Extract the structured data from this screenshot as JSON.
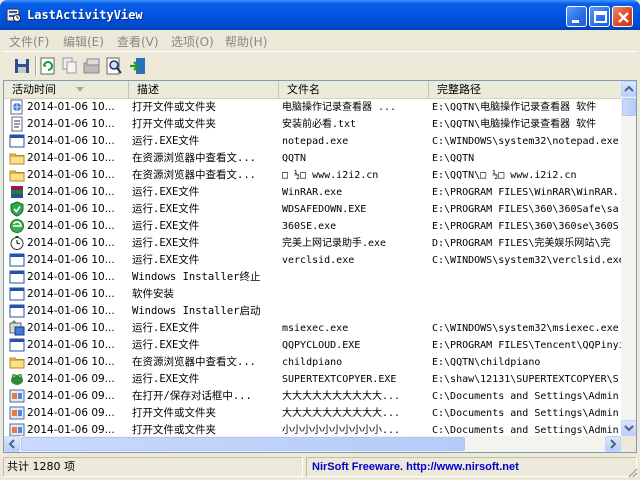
{
  "window": {
    "title": "LastActivityView"
  },
  "menu": [
    {
      "label": "文件(F)"
    },
    {
      "label": "编辑(E)"
    },
    {
      "label": "查看(V)"
    },
    {
      "label": "选项(O)"
    },
    {
      "label": "帮助(H)"
    }
  ],
  "toolbar": {
    "icons": [
      "save-icon",
      "refresh-icon",
      "copy-icon",
      "properties-icon",
      "find-icon",
      "exit-icon"
    ]
  },
  "table": {
    "columns": [
      "活动时间",
      "描述",
      "文件名",
      "完整路径"
    ],
    "sort_column": "活动时间",
    "rows": [
      {
        "icon": "html-file-icon",
        "time": "2014-01-06 10...",
        "desc": "打开文件或文件夹",
        "file": "电脑操作记录查看器 ...",
        "path": "E:\\QQTN\\电脑操作记录查看器 软件"
      },
      {
        "icon": "text-file-icon",
        "time": "2014-01-06 10...",
        "desc": "打开文件或文件夹",
        "file": "安装前必看.txt",
        "path": "E:\\QQTN\\电脑操作记录查看器 软件"
      },
      {
        "icon": "window-icon",
        "time": "2014-01-06 10...",
        "desc": "运行.EXE文件",
        "file": "notepad.exe",
        "path": "C:\\WINDOWS\\system32\\notepad.exe"
      },
      {
        "icon": "folder-icon",
        "time": "2014-01-06 10...",
        "desc": "在资源浏览器中查看文...",
        "file": "QQTN",
        "path": "E:\\QQTN"
      },
      {
        "icon": "folder-icon",
        "time": "2014-01-06 10...",
        "desc": "在资源浏览器中查看文...",
        "file": "□ ½□  www.i2i2.cn",
        "path": "E:\\QQTN\\□ ½□  www.i2i2.cn"
      },
      {
        "icon": "winrar-icon",
        "time": "2014-01-06 10...",
        "desc": "运行.EXE文件",
        "file": "WinRAR.exe",
        "path": "E:\\PROGRAM FILES\\WinRAR\\WinRAR."
      },
      {
        "icon": "shield-icon",
        "time": "2014-01-06 10...",
        "desc": "运行.EXE文件",
        "file": "WDSAFEDOWN.EXE",
        "path": "E:\\PROGRAM FILES\\360\\360Safe\\sa"
      },
      {
        "icon": "browser-icon",
        "time": "2014-01-06 10...",
        "desc": "运行.EXE文件",
        "file": "360SE.exe",
        "path": "E:\\PROGRAM FILES\\360\\360se\\360S"
      },
      {
        "icon": "clock-icon",
        "time": "2014-01-06 10...",
        "desc": "运行.EXE文件",
        "file": "完美上网记录助手.exe",
        "path": "D:\\PROGRAM FILES\\完美娱乐网站\\完"
      },
      {
        "icon": "window-icon",
        "time": "2014-01-06 10...",
        "desc": "运行.EXE文件",
        "file": "verclsid.exe",
        "path": "C:\\WINDOWS\\system32\\verclsid.exe"
      },
      {
        "icon": "window-icon",
        "time": "2014-01-06 10...",
        "desc": "Windows Installer终止",
        "file": "",
        "path": ""
      },
      {
        "icon": "window-icon",
        "time": "2014-01-06 10...",
        "desc": "软件安装",
        "file": "",
        "path": ""
      },
      {
        "icon": "window-icon",
        "time": "2014-01-06 10...",
        "desc": "Windows Installer启动",
        "file": "",
        "path": ""
      },
      {
        "icon": "installer-icon",
        "time": "2014-01-06 10...",
        "desc": "运行.EXE文件",
        "file": "msiexec.exe",
        "path": "C:\\WINDOWS\\system32\\msiexec.exe"
      },
      {
        "icon": "window-icon",
        "time": "2014-01-06 10...",
        "desc": "运行.EXE文件",
        "file": "QQPYCLOUD.EXE",
        "path": "E:\\PROGRAM FILES\\Tencent\\QQPinyi"
      },
      {
        "icon": "folder-icon",
        "time": "2014-01-06 10...",
        "desc": "在资源浏览器中查看文...",
        "file": "childpiano",
        "path": "E:\\QQTN\\childpiano"
      },
      {
        "icon": "frog-icon",
        "time": "2014-01-06 09...",
        "desc": "运行.EXE文件",
        "file": "SUPERTEXTCOPYER.EXE",
        "path": "E:\\shaw\\12131\\SUPERTEXTCOPYER\\S"
      },
      {
        "icon": "dialog-icon",
        "time": "2014-01-06 09...",
        "desc": "在打开/保存对话框中...",
        "file": "大大大大大大大大大大...",
        "path": "C:\\Documents and Settings\\Admin"
      },
      {
        "icon": "dialog-icon",
        "time": "2014-01-06 09...",
        "desc": "打开文件或文件夹",
        "file": "大大大大大大大大大大...",
        "path": "C:\\Documents and Settings\\Admin"
      },
      {
        "icon": "dialog-icon",
        "time": "2014-01-06 09...",
        "desc": "打开文件或文件夹",
        "file": "小小小小小小小小小小...",
        "path": "C:\\Documents and Settings\\Admin"
      }
    ]
  },
  "status": {
    "count": "共计 1280 项",
    "credit": "NirSoft Freeware.  http://www.nirsoft.net"
  },
  "colors": {
    "title_bar": "#0054e3",
    "credit_link": "#0000cc",
    "window_bg": "#ece9d8"
  }
}
